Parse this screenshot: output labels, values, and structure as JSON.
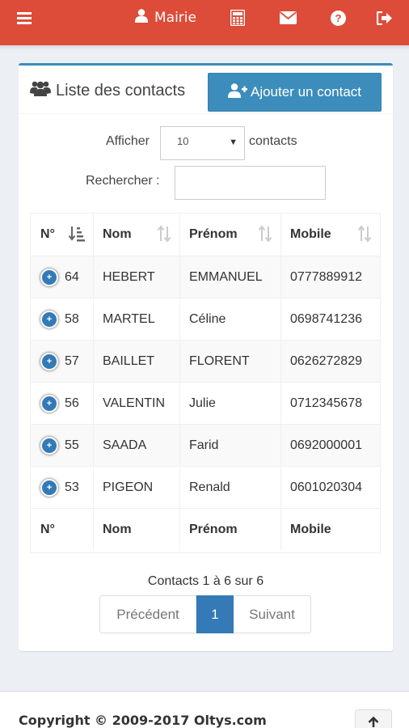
{
  "topbar": {
    "user_label": "Mairie",
    "icons": [
      "menu-icon",
      "user-icon",
      "calculator-icon",
      "envelope-icon",
      "question-icon",
      "sign-out-icon"
    ]
  },
  "box": {
    "title": "Liste des contacts",
    "add_button": "Ajouter un contact"
  },
  "filters": {
    "show_label": "Afficher",
    "length_value": "10",
    "contacts_label": "contacts",
    "search_label": "Rechercher :"
  },
  "table": {
    "headers": [
      "N°",
      "Nom",
      "Prénom",
      "Mobile"
    ],
    "footers": [
      "N°",
      "Nom",
      "Prénom",
      "Mobile"
    ],
    "rows": [
      {
        "num": "64",
        "nom": "HEBERT",
        "prenom": "EMMANUEL",
        "mobile": "0777889912"
      },
      {
        "num": "58",
        "nom": "MARTEL",
        "prenom": "Céline",
        "mobile": "0698741236"
      },
      {
        "num": "57",
        "nom": "BAILLET",
        "prenom": "FLORENT",
        "mobile": "0626272829"
      },
      {
        "num": "56",
        "nom": "VALENTIN",
        "prenom": "Julie",
        "mobile": "0712345678"
      },
      {
        "num": "55",
        "nom": "SAADA",
        "prenom": "Farid",
        "mobile": "0692000001"
      },
      {
        "num": "53",
        "nom": "PIGEON",
        "prenom": "Renald",
        "mobile": "0601020304"
      }
    ],
    "expand_symbol": "+"
  },
  "pagination": {
    "info": "Contacts 1 à 6 sur 6",
    "prev": "Précédent",
    "current": "1",
    "next": "Suivant"
  },
  "footer": {
    "copyright": "Copyright © 2009-2017 Oltys.com"
  },
  "colors": {
    "topbar": "#dd4b39",
    "primary": "#3c8dbc",
    "pagination_active": "#337ab7"
  }
}
